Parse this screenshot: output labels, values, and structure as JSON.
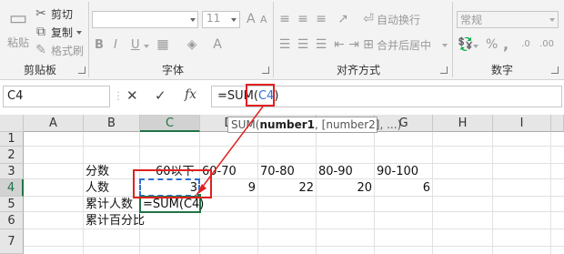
{
  "ribbon": {
    "clipboard": {
      "paste": "粘贴",
      "cut": "剪切",
      "copy": "复制",
      "format_painter": "格式刷",
      "group_label": "剪贴板"
    },
    "font": {
      "font_size": "11",
      "group_label": "字体",
      "bold": "B",
      "italic": "I",
      "underline": "U",
      "grow": "A",
      "shrink": "A"
    },
    "alignment": {
      "wrap_text": "自动换行",
      "merge_center": "合并后居中",
      "group_label": "对齐方式"
    },
    "number": {
      "format": "常规",
      "percent": "%",
      "comma": ",",
      "group_label": "数字"
    }
  },
  "formula_bar": {
    "name_box": "C4",
    "cancel": "✕",
    "enter": "✓",
    "fx": "fx",
    "formula_prefix": "=SUM(",
    "formula_ref": "C4",
    "formula_suffix": ")"
  },
  "tooltip": {
    "fn": "SUM(",
    "arg1": "number1",
    "rest": ", [number2], ...)"
  },
  "columns": [
    "A",
    "B",
    "C",
    "D",
    "E",
    "F",
    "G",
    "H",
    "I"
  ],
  "rows": [
    "1",
    "2",
    "3",
    "4",
    "5",
    "6",
    "7"
  ],
  "cells": {
    "B3": "分数",
    "C3": "60以下",
    "D3": "60-70",
    "E3": "70-80",
    "F3": "80-90",
    "G3": "90-100",
    "B4": "人数",
    "C4": "3",
    "D4": "9",
    "E4": "22",
    "F4": "20",
    "G4": "6",
    "B5": "累计人数",
    "C5": "=SUM(C4)",
    "B6": "累计百分比"
  },
  "colors": {
    "excel_green": "#217346",
    "annotation_red": "#e02020",
    "ref_blue": "#2f6fd0"
  }
}
